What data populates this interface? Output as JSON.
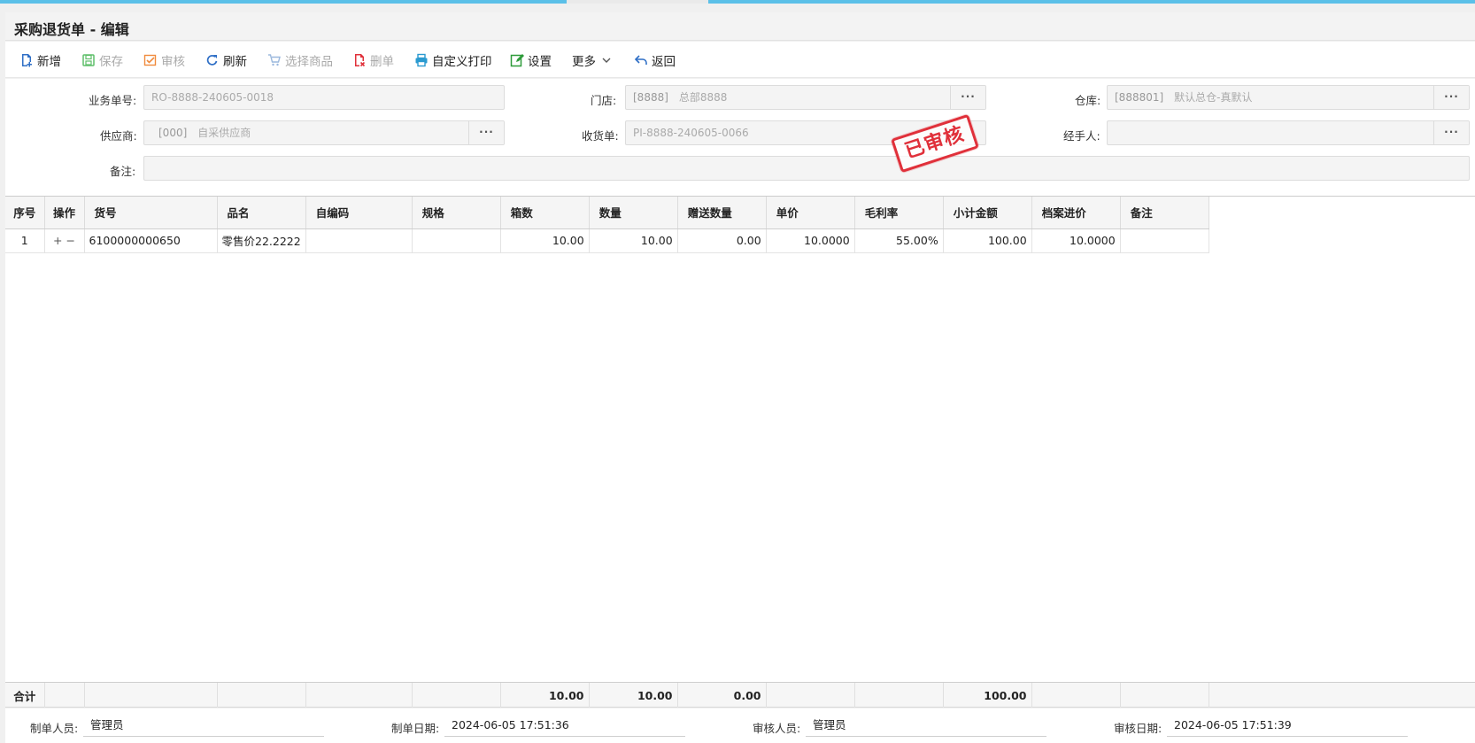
{
  "page": {
    "title": "采购退货单 - 编辑"
  },
  "toolbar": {
    "new": "新增",
    "save": "保存",
    "audit": "审核",
    "refresh": "刷新",
    "select_goods": "选择商品",
    "delete": "删单",
    "custom_print": "自定义打印",
    "settings": "设置",
    "more": "更多",
    "back": "返回"
  },
  "form": {
    "bill_no_label": "业务单号:",
    "bill_no": "RO-8888-240605-0018",
    "store_label": "门店:",
    "store_code": "[8888]",
    "store_name": "总部8888",
    "warehouse_label": "仓库:",
    "warehouse_code": "[888801]",
    "warehouse_name": "默认总仓-真默认",
    "supplier_label": "供应商:",
    "supplier_code": "[000]",
    "supplier_name": "自采供应商",
    "receipt_label": "收货单:",
    "receipt_no": "PI-8888-240605-0066",
    "handler_label": "经手人:",
    "handler": "",
    "remark_label": "备注:",
    "remark": "",
    "more_btn": "···"
  },
  "stamp": {
    "text": "已审核",
    "color": "#e0303a"
  },
  "table": {
    "headers": [
      "序号",
      "操作",
      "货号",
      "品名",
      "自编码",
      "规格",
      "箱数",
      "数量",
      "赠送数量",
      "单价",
      "毛利率",
      "小计金额",
      "档案进价",
      "备注"
    ],
    "rows": [
      {
        "seq": "1",
        "op": "+  −",
        "code": "6100000000650",
        "name": "零售价22.2222",
        "self_code": "",
        "spec": "",
        "boxes": "10.00",
        "qty": "10.00",
        "gift_qty": "0.00",
        "price": "10.0000",
        "margin": "55.00%",
        "subtotal": "100.00",
        "file_price": "10.0000",
        "remark": ""
      }
    ],
    "total": {
      "label": "合计",
      "boxes": "10.00",
      "qty": "10.00",
      "gift_qty": "0.00",
      "subtotal": "100.00"
    }
  },
  "footer": {
    "maker_label": "制单人员:",
    "maker": "管理员",
    "make_date_label": "制单日期:",
    "make_date": "2024-06-05 17:51:36",
    "auditor_label": "审核人员:",
    "auditor": "管理员",
    "audit_date_label": "审核日期:",
    "audit_date": "2024-06-05 17:51:39"
  },
  "colors": {
    "accent": "#5bc0e8",
    "stamp": "#e0303a",
    "icon_blue": "#2f6fc6",
    "icon_green": "#2e9b3a",
    "icon_red": "#e0303a",
    "icon_orange": "#f08a3c"
  }
}
